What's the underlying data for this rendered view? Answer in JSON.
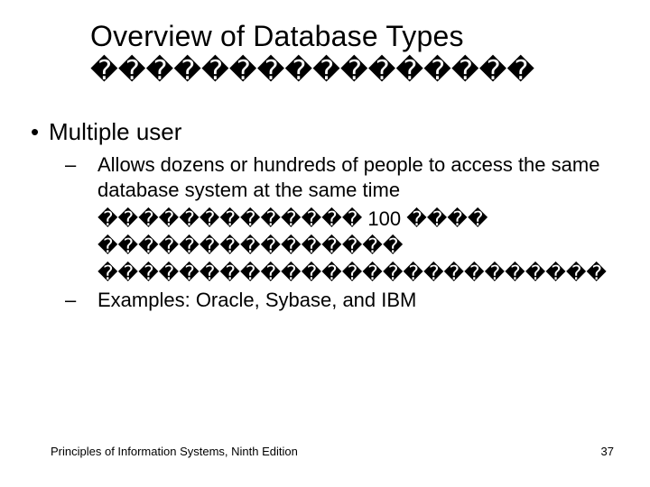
{
  "title": {
    "line1": "Overview of Database Types",
    "line2": "����������������"
  },
  "body": {
    "bullet_l1": "Multiple user",
    "sub1_main": "Allows dozens or hundreds of people to access the same database system at the same time",
    "sub1_extra1": "������������� 100 ����",
    "sub1_extra2": "���������������",
    "sub1_extra3": "�������������������������",
    "sub2": "Examples: Oracle, Sybase, and IBM"
  },
  "footer": {
    "left": "Principles of Information Systems, Ninth Edition",
    "page": "37"
  }
}
